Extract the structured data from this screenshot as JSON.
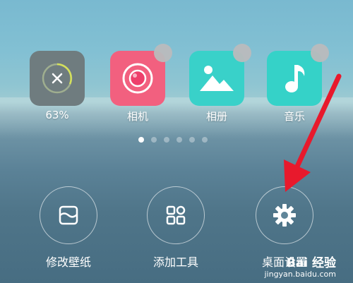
{
  "apps": [
    {
      "name": "clean",
      "label": "63%",
      "icon": "clean-close-icon",
      "color": "#6f7c7f"
    },
    {
      "name": "camera",
      "label": "相机",
      "icon": "camera-icon",
      "color": "#f2607f"
    },
    {
      "name": "gallery",
      "label": "相册",
      "icon": "gallery-icon",
      "color": "#39d1c9"
    },
    {
      "name": "music",
      "label": "音乐",
      "icon": "music-note-icon",
      "color": "#35d2c8"
    }
  ],
  "page_indicator": {
    "count": 6,
    "active": 0
  },
  "tools": [
    {
      "name": "wallpaper",
      "label": "修改壁纸",
      "icon": "wallpaper-icon"
    },
    {
      "name": "add-widget",
      "label": "添加工具",
      "icon": "grid-icon"
    },
    {
      "name": "desktop-settings",
      "label": "桌面设置",
      "icon": "gear-icon"
    }
  ],
  "watermark": {
    "title": "Bai 经验",
    "url": "jingyan.baidu.com"
  },
  "accent": {
    "arrow": "#e8192c"
  }
}
